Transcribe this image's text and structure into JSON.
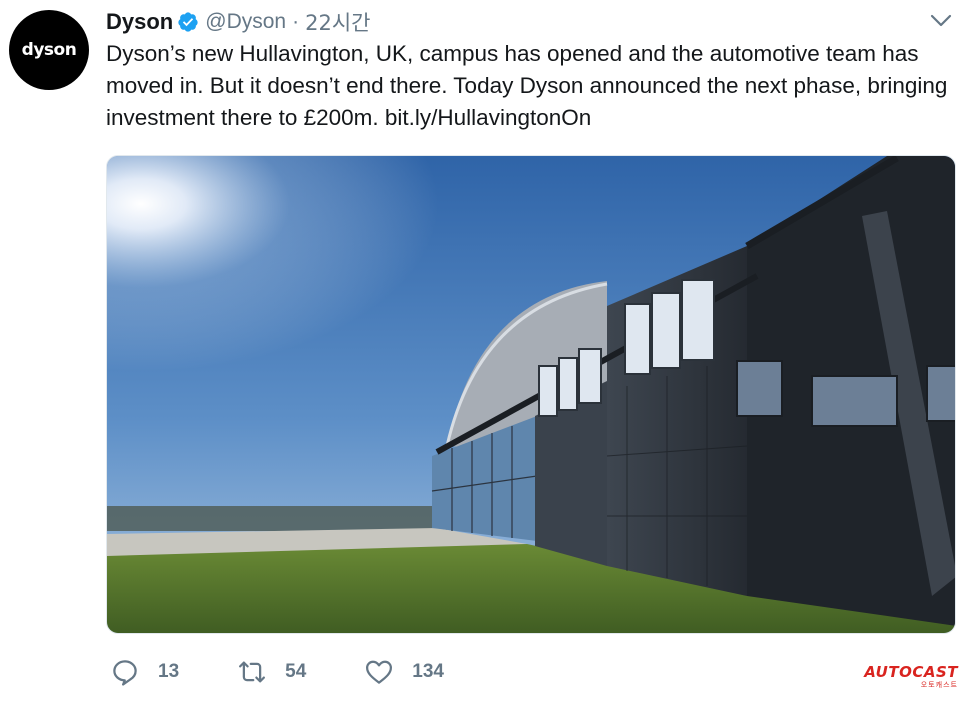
{
  "author": {
    "avatar_text": "dyson",
    "display_name": "Dyson",
    "handle": "@Dyson",
    "separator": "·",
    "time": "22시간",
    "verified": true
  },
  "tweet": {
    "text_before_link": "Dyson’s new Hullavington, UK, campus has opened and the automotive team has moved in. But it doesn’t end there. Today Dyson announced the next phase, bringing investment there to £200m. ",
    "link": "bit.ly/HullavingtonOn"
  },
  "media": {
    "description_icon": "hangar-photo",
    "sky_color": "#3f74b6",
    "building_color": "#2b3038"
  },
  "actions": {
    "reply_count": "13",
    "retweet_count": "54",
    "like_count": "134"
  },
  "watermark": {
    "main": "AUTOCAST",
    "sub": "오토캐스트"
  },
  "colors": {
    "text": "#14171a",
    "secondary": "#657786",
    "verified": "#1da1f2",
    "watermark": "#d9241f"
  }
}
